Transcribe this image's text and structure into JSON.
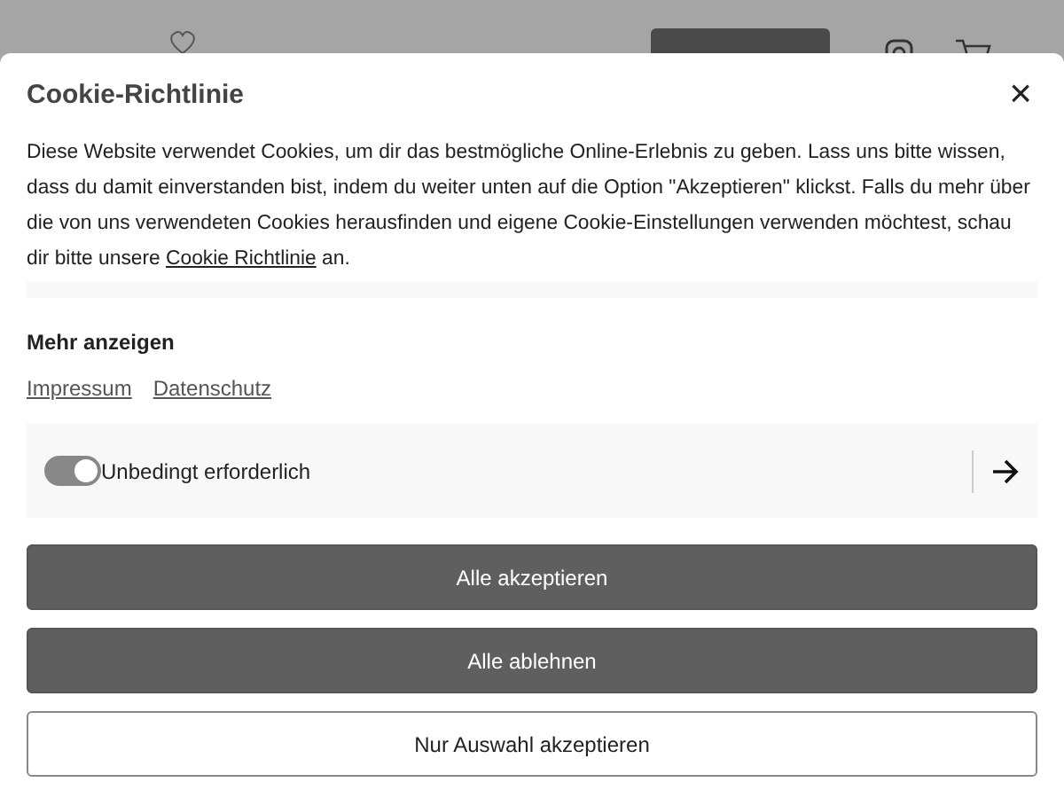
{
  "dialog": {
    "title": "Cookie-Richtlinie",
    "close": "×",
    "text": "Diese Website verwendet Cookies, um dir das bestmögliche Online-Erlebnis zu geben. Lass uns bitte wissen, dass du damit einverstanden bist, indem du weiter unten auf die Option \"Akzeptieren\" klickst. Falls du mehr über die von uns verwendeten Cookies herausfinden und eigene Cookie-Einstellungen verwenden möchtest, schau dir bitte unsere ",
    "policy_link": "Cookie Richtlinie",
    "text_end": " an.",
    "more": "Mehr anzeigen",
    "links": [
      "Impressum",
      "Datenschutz"
    ],
    "categories": [
      {
        "label": "Unbedingt erforderlich",
        "on": true
      }
    ],
    "buttons": [
      {
        "label": "Alle akzeptieren",
        "kind": "filled"
      },
      {
        "label": "Alle ablehnen",
        "kind": "filled"
      },
      {
        "label": "Nur Auswahl akzeptieren",
        "kind": "outline"
      }
    ]
  }
}
